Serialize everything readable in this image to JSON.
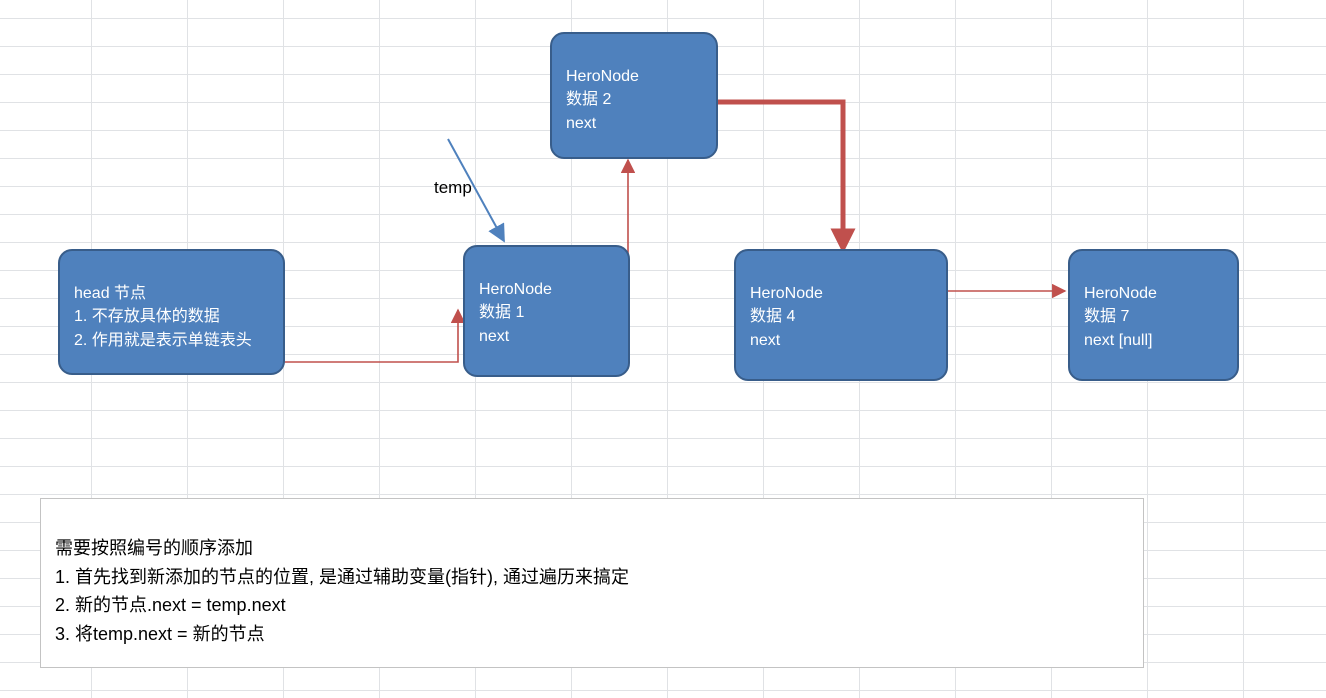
{
  "tempLabel": "temp",
  "nodes": {
    "head": {
      "lines": "head 节点\n1. 不存放具体的数据\n2. 作用就是表示单链表头"
    },
    "n1": {
      "lines": "HeroNode\n数据 1\nnext"
    },
    "n2": {
      "lines": "HeroNode\n数据 2\nnext"
    },
    "n4": {
      "lines": "HeroNode\n数据 4\nnext"
    },
    "n7": {
      "lines": "HeroNode\n数据 7\nnext [null]"
    }
  },
  "explanation": "需要按照编号的顺序添加\n1. 首先找到新添加的节点的位置, 是通过辅助变量(指针), 通过遍历来搞定\n2. 新的节点.next = temp.next\n3. 将temp.next = 新的节点",
  "colors": {
    "nodeFill": "#4f81bd",
    "nodeBorder": "#385d8a",
    "arrowThin": "#c0504d",
    "arrowThick": "#c0504d",
    "tempArrow": "#4f81bd",
    "grid": "#e0e2e5"
  }
}
